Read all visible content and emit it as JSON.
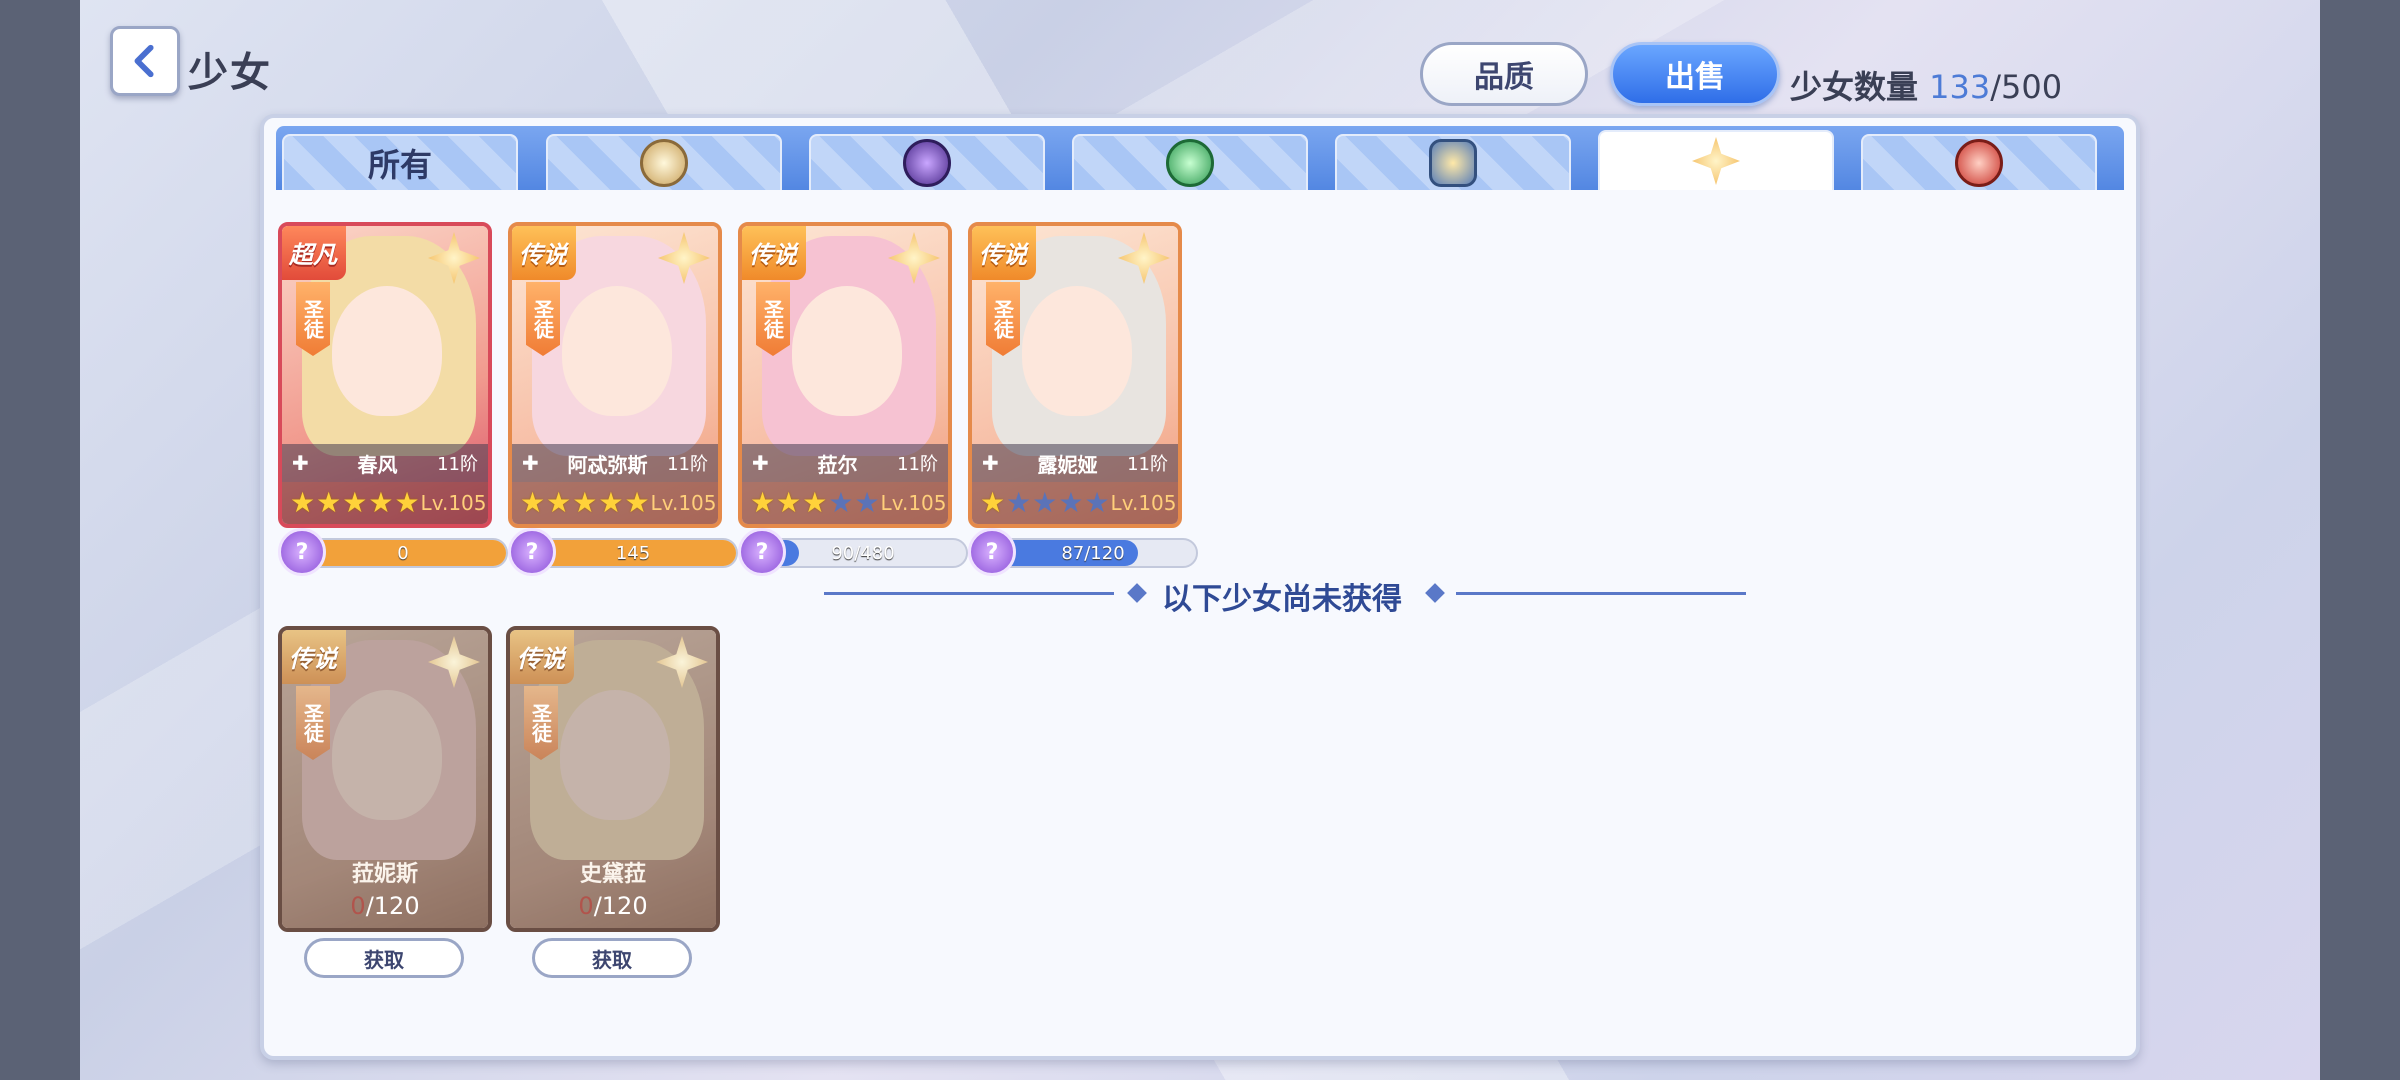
{
  "header": {
    "title": "少女",
    "quality_label": "品质",
    "sell_label": "出售",
    "count_label": "少女数量",
    "count_current": "133",
    "count_sep_max": "/500"
  },
  "tabs": [
    {
      "label": "所有",
      "icon": "all"
    },
    {
      "label": "",
      "icon": "light-element-icon"
    },
    {
      "label": "",
      "icon": "dark-element-icon"
    },
    {
      "label": "",
      "icon": "wind-element-icon"
    },
    {
      "label": "",
      "icon": "earth-element-icon"
    },
    {
      "label": "",
      "icon": "holy-element-icon",
      "active": true
    },
    {
      "label": "",
      "icon": "fire-element-icon"
    }
  ],
  "owned": [
    {
      "rarity": "超凡",
      "class": "圣徒",
      "name": "春风",
      "stage": "11阶",
      "stars": 5,
      "level": "Lv.105",
      "shards": "0",
      "fill": 1.0,
      "palette": "red"
    },
    {
      "rarity": "传说",
      "class": "圣徒",
      "name": "阿忒弥斯",
      "stage": "11阶",
      "stars": 5,
      "level": "Lv.105",
      "shards": "145",
      "fill": 1.0,
      "palette": "orange"
    },
    {
      "rarity": "传说",
      "class": "圣徒",
      "name": "菈尔",
      "stage": "11阶",
      "stars": 3,
      "level": "Lv.105",
      "shards": "90/480",
      "fill": 0.19,
      "palette": "orange"
    },
    {
      "rarity": "传说",
      "class": "圣徒",
      "name": "露妮娅",
      "stage": "11阶",
      "stars": 1,
      "level": "Lv.105",
      "shards": "87/120",
      "fill": 0.72,
      "palette": "orange"
    }
  ],
  "divider_text": "以下少女尚未获得",
  "locked": [
    {
      "rarity": "传说",
      "class": "圣徒",
      "name": "菈妮斯",
      "progress_zero": "0",
      "progress_rest": "/120",
      "button": "获取"
    },
    {
      "rarity": "传说",
      "class": "圣徒",
      "name": "史黛菈",
      "progress_zero": "0",
      "progress_rest": "/120",
      "button": "获取"
    }
  ],
  "colors": {
    "accent": "#4d7bd6",
    "tab_bar": "#5387e2",
    "shard_fill_full": "#f2a13a",
    "shard_fill_partial": "#4a7ae0"
  }
}
